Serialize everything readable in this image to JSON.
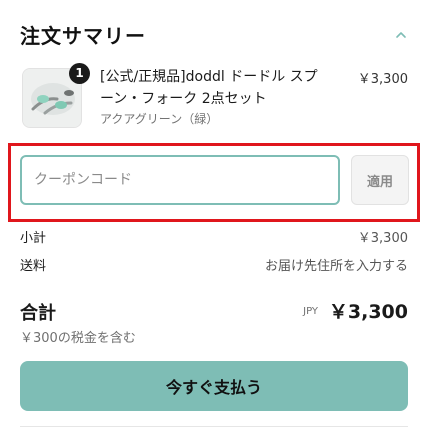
{
  "summary": {
    "title": "注文サマリー",
    "toggle_icon": "chevron-up-icon",
    "accent_color": "#7ebdb5"
  },
  "product": {
    "quantity": "1",
    "name": "[公式/正規品]doddl ドードル スプーン・フォーク 2点セット",
    "variant": "アクアグリーン（緑）",
    "price": "￥3,300"
  },
  "coupon": {
    "placeholder": "クーポンコード",
    "value": "",
    "apply_label": "適用",
    "highlight_color": "#e0161c"
  },
  "subtotal": {
    "label": "小計",
    "value": "￥3,300"
  },
  "shipping": {
    "label": "送料",
    "value": "お届け先住所を入力する"
  },
  "total": {
    "label": "合計",
    "currency": "JPY",
    "value": "￥3,300"
  },
  "tax_note": "￥300の税金を含む",
  "pay_button": {
    "label": "今すぐ支払う"
  }
}
